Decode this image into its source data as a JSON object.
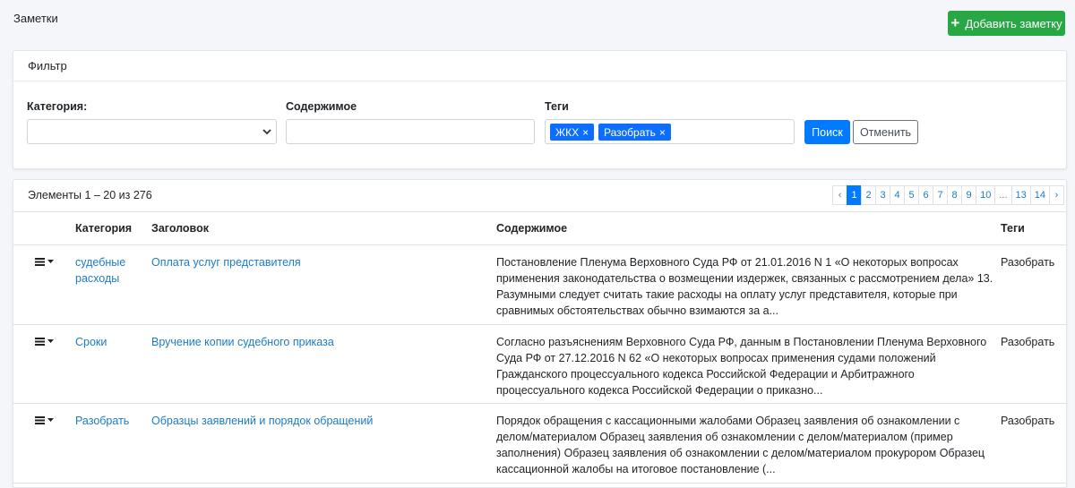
{
  "page": {
    "title": "Заметки",
    "add_button_label": "Добавить заметку"
  },
  "filter": {
    "header": "Фильтр",
    "category_label": "Категория:",
    "category_value": "",
    "content_label": "Содержимое",
    "content_value": "",
    "tags_label": "Теги",
    "tags": [
      "ЖКХ",
      "Разобрать"
    ],
    "search_button": "Поиск",
    "cancel_button": "Отменить"
  },
  "list": {
    "info": "Элементы 1 – 20 из 276",
    "pagination": {
      "prev": "‹",
      "pages": [
        "1",
        "2",
        "3",
        "4",
        "5",
        "6",
        "7",
        "8",
        "9",
        "10",
        "...",
        "13",
        "14"
      ],
      "active": "1",
      "next": "›"
    },
    "columns": {
      "category": "Категория",
      "title": "Заголовок",
      "content": "Содержимое",
      "tags": "Теги"
    },
    "rows": [
      {
        "category": "судебные расходы",
        "title": "Оплата услуг представителя",
        "content": "Постановление Пленума Верховного Суда РФ от 21.01.2016 N 1 «О некоторых вопросах применения законодательства о возмещении издержек, связанных с рассмотрением дела» 13. Разумными следует считать такие расходы на оплату услуг представителя, которые при сравнимых обстоятельствах обычно взимаются за а...",
        "tags": "Разобрать"
      },
      {
        "category": "Сроки",
        "title": "Вручение копии судебного приказа",
        "content": "Согласно разъяснениям Верховного Суда РФ, данным в Постановлении Пленума Верховного Суда РФ от 27.12.2016 N 62 «О некоторых вопросах применения судами положений Гражданского процессуального кодекса Российской Федерации и Арбитражного процессуального кодекса Российской Федерации о приказно...",
        "tags": "Разобрать"
      },
      {
        "category": "Разобрать",
        "title": "Образцы заявлений и порядок обращений",
        "content": "Порядок обращения с кассационными жалобами   Образец заявления об ознакомлении с делом/материалом Образец заявления об ознакомлении с делом/материалом (пример заполнения) Образец заявления об ознакомлении с делом/материалом прокурором Образец кассационной жалобы на итоговое постановление (...",
        "tags": "Разобрать"
      }
    ]
  },
  "icons": {
    "add": "plus-icon",
    "select": "chevron-down-icon",
    "row_menu": "hamburger-icon"
  },
  "colors": {
    "primary": "#007bff",
    "success": "#28a745",
    "link": "#1a7cc4"
  }
}
